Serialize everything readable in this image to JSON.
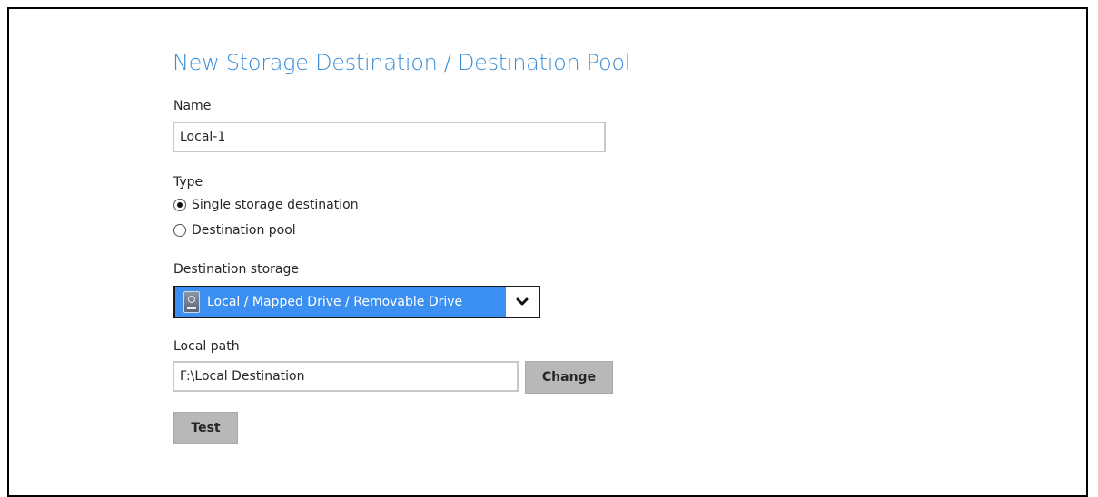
{
  "title": "New Storage Destination / Destination Pool",
  "name_field": {
    "label": "Name",
    "value": "Local-1"
  },
  "type": {
    "label": "Type",
    "options": [
      {
        "label": "Single storage destination",
        "checked": true
      },
      {
        "label": "Destination pool",
        "checked": false
      }
    ]
  },
  "destination_storage": {
    "label": "Destination storage",
    "selected": "Local / Mapped Drive / Removable Drive",
    "icon": "hard-drive-icon",
    "highlight_color": "#3b8ff0"
  },
  "local_path": {
    "label": "Local path",
    "value": "F:\\Local Destination",
    "change_label": "Change"
  },
  "test_label": "Test"
}
